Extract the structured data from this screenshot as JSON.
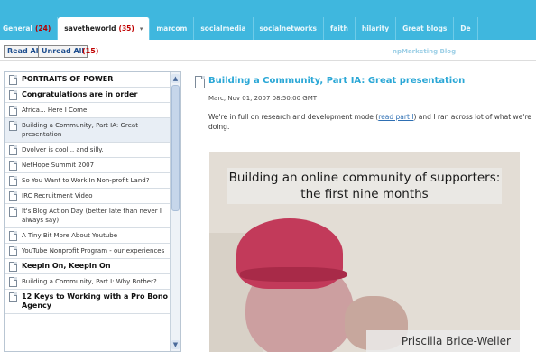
{
  "tabs": [
    {
      "label": "General",
      "count": "(24)",
      "active": false
    },
    {
      "label": "savetheworld",
      "count": "(35)",
      "active": true
    },
    {
      "label": "marcom",
      "count": "",
      "active": false
    },
    {
      "label": "socialmedia",
      "count": "",
      "active": false
    },
    {
      "label": "socialnetworks",
      "count": "",
      "active": false
    },
    {
      "label": "faith",
      "count": "",
      "active": false
    },
    {
      "label": "hilarity",
      "count": "",
      "active": false
    },
    {
      "label": "Great blogs",
      "count": "",
      "active": false
    },
    {
      "label": "De",
      "count": "",
      "active": false
    }
  ],
  "toolbar": {
    "read_all": "Read All",
    "unread_all": "Unread All",
    "unread_count": "(15)",
    "blog_title": "npMarketing Blog"
  },
  "sidebar": {
    "items": [
      {
        "label": "PORTRAITS OF POWER",
        "bold": true,
        "selected": false
      },
      {
        "label": "Congratulations are in order",
        "bold": true,
        "selected": false
      },
      {
        "label": "Africa... Here I Come",
        "bold": false,
        "selected": false
      },
      {
        "label": "Building a Community, Part IA: Great presentation",
        "bold": false,
        "selected": true
      },
      {
        "label": "Dvolver is cool... and silly.",
        "bold": false,
        "selected": false
      },
      {
        "label": "NetHope Summit 2007",
        "bold": false,
        "selected": false
      },
      {
        "label": "So You Want to Work In Non-profit Land?",
        "bold": false,
        "selected": false
      },
      {
        "label": "IRC Recruitment Video",
        "bold": false,
        "selected": false
      },
      {
        "label": "It's Blog Action Day (better late than never I always say)",
        "bold": false,
        "selected": false
      },
      {
        "label": "A Tiny Bit More About Youtube",
        "bold": false,
        "selected": false
      },
      {
        "label": "YouTube Nonprofit Program - our experiences",
        "bold": false,
        "selected": false
      },
      {
        "label": "Keepin On, Keepin On",
        "bold": true,
        "selected": false
      },
      {
        "label": "Building a Community, Part I: Why Bother?",
        "bold": false,
        "selected": false
      },
      {
        "label": "12 Keys to Working with a Pro Bono Agency",
        "bold": true,
        "selected": false
      }
    ]
  },
  "post": {
    "title": "Building a Community, Part IA: Great presentation",
    "date": "Marc, Nov 01, 2007 08:50:00 GMT",
    "body_before": "We're in full on research and development mode (",
    "body_link": "read part I",
    "body_after": ") and I ran across lot of what we're doing.",
    "slide_title_line1": "Building an online community of supporters:",
    "slide_title_line2": "the first nine months",
    "slide_caption": "Priscilla Brice-Weller"
  }
}
